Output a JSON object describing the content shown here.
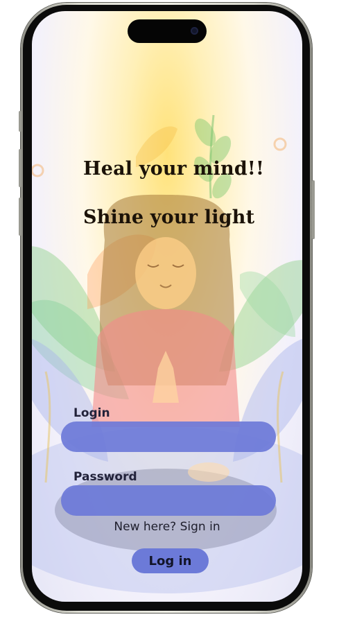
{
  "headline": {
    "line1": "Heal your mind!!",
    "line2": "Shine your light"
  },
  "form": {
    "login_label": "Login",
    "login_value": "",
    "password_label": "Password",
    "password_value": "",
    "signup_text": "New here? Sign in",
    "login_button": "Log in"
  },
  "colors": {
    "accent": "#6c7ad8",
    "headline": "#1b1208",
    "glow": "#ffe27a"
  },
  "illustration": {
    "subject": "meditating-woman-illustration"
  }
}
